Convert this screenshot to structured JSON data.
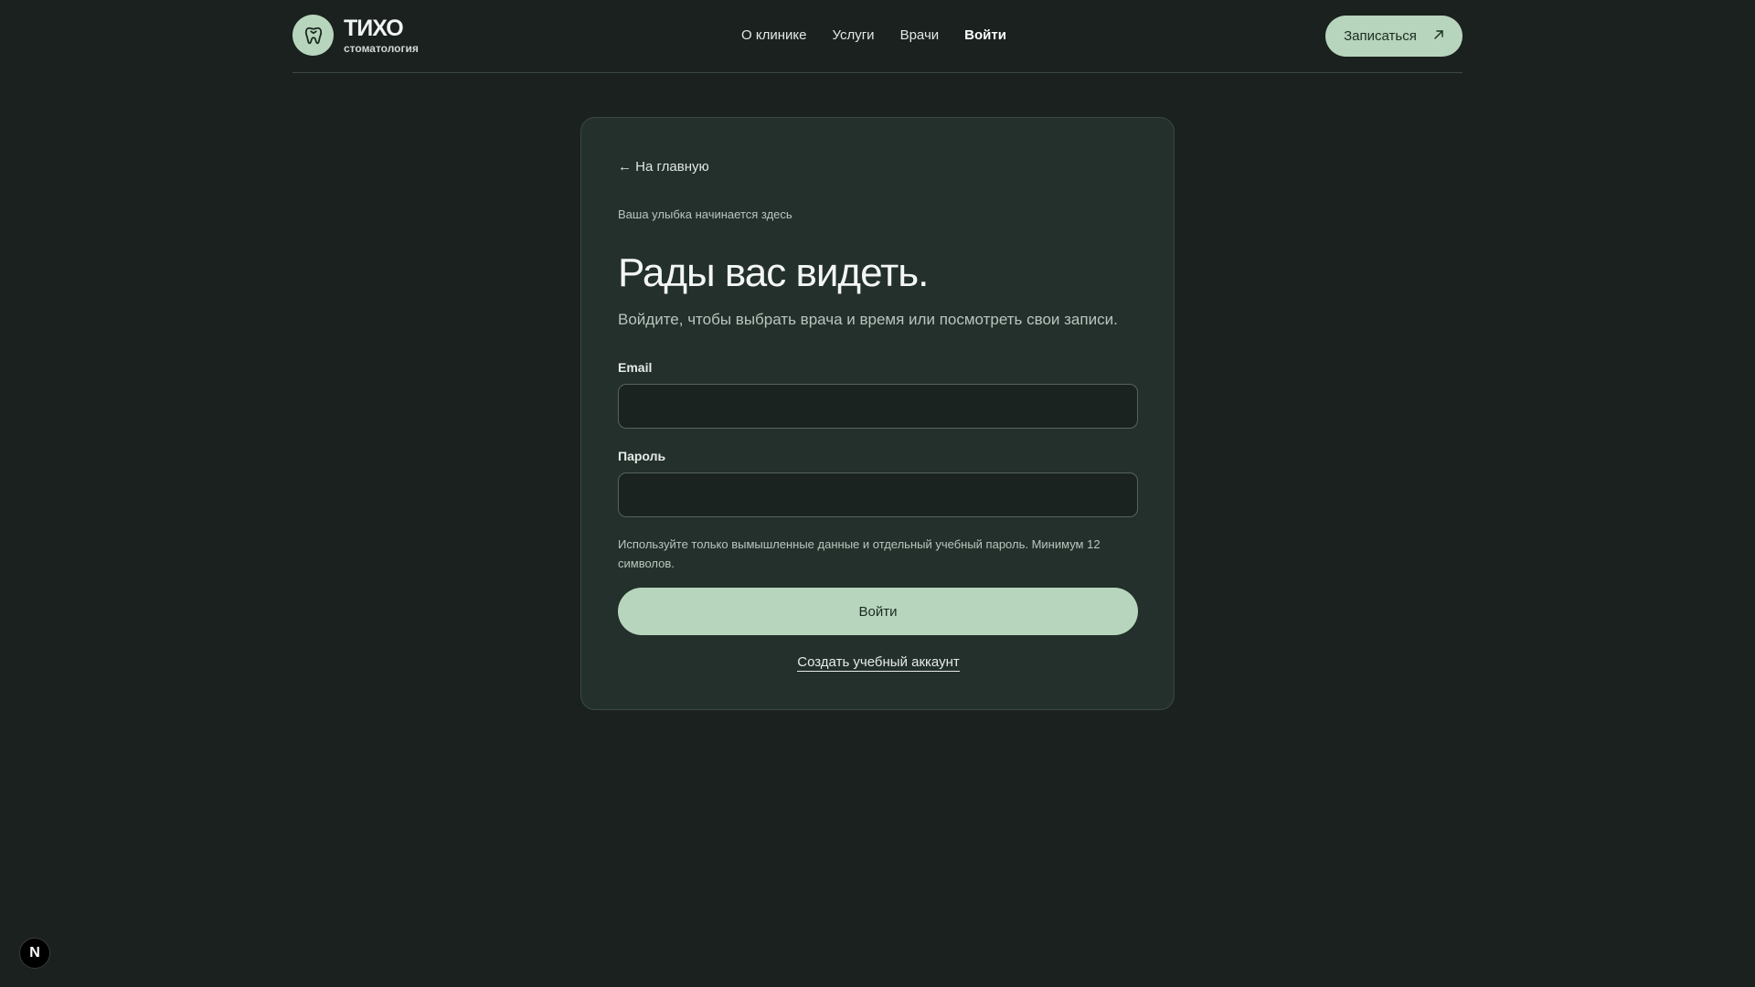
{
  "brand": {
    "name": "ТИХО",
    "tagline": "стоматология",
    "icon": "tooth-icon"
  },
  "nav": {
    "items": [
      {
        "label": "О клинике"
      },
      {
        "label": "Услуги"
      },
      {
        "label": "Врачи"
      },
      {
        "label": "Войти",
        "active": true
      }
    ]
  },
  "cta": {
    "label": "Записаться",
    "icon": "arrow-up-right-icon"
  },
  "login": {
    "back_label": "← На главную",
    "kicker": "Ваша улыбка начинается здесь",
    "title": "Рады вас видеть.",
    "lead": "Войдите, чтобы выбрать врача и время или посмотреть свои записи.",
    "email_label": "Email",
    "email_value": "",
    "password_label": "Пароль",
    "password_value": "",
    "hint": "Используйте только вымышленные данные и отдельный учебный пароль. Минимум 12 символов.",
    "submit_label": "Войти",
    "create_label": "Создать учебный аккаунт"
  },
  "badge": {
    "label": "N"
  },
  "colors": {
    "background": "#1a211e",
    "card": "#24302b",
    "accent": "#b7d5bc"
  }
}
